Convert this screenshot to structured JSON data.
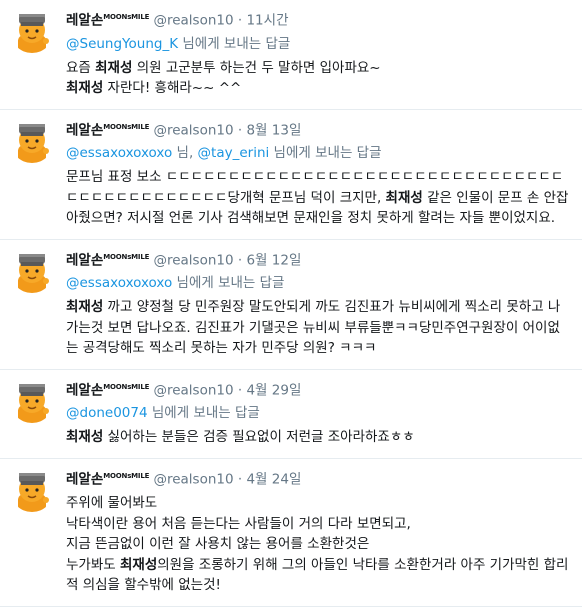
{
  "user": {
    "name": "레알손",
    "badge": "MOONsMILE",
    "handle": "@realson10"
  },
  "reply_suffix": "님에게 보내는 답글",
  "highlight": "최재성",
  "tweets": [
    {
      "time": "11시간",
      "reply_to": "@SeungYoung_K",
      "reply_to_2": "",
      "lines": [
        [
          "요즘 ",
          "최재성",
          " 의원 고군분투 하는건 두 말하면 입아파요~"
        ],
        [
          "",
          "최재성",
          " 자란다! 흥해라~~ ^^"
        ]
      ]
    },
    {
      "time": "8월 13일",
      "reply_to": "@essaxoxoxoxo",
      "reply_to_2": "@tay_erini",
      "lines": [
        [
          "문프님 표정 보소 ㄷㄷㄷㄷㄷㄷㄷㄷㄷㄷㄷㄷㄷㄷㄷㄷㄷㄷㄷㄷㄷㄷㄷㄷㄷㄷㄷㄷㄷㄷㄷㄷㄷㄷㄷㄷㄷㄷㄷㄷㄷㄷㄷㄷㄷ당개혁 문프님 덕이 크지만, ",
          "최재성",
          " 같은 인물이 문프 손 안잡아줬으면? 저시절 언론 기사 검색해보면 문재인을 정치 못하게 할려는 자들 뿐이었지요."
        ]
      ]
    },
    {
      "time": "6월 12일",
      "reply_to": "@essaxoxoxoxo",
      "reply_to_2": "",
      "lines": [
        [
          "",
          "최재성",
          " 까고 양정철 당 민주원장 말도안되게 까도 김진표가 뉴비씨에게 찍소리 못하고 나가는것 보면 답나오죠. 김진표가 기댈곳은 뉴비씨 부류들뿐ㅋㅋ당민주연구원장이 어이없는 공격당해도 찍소리 못하는 자가 민주당 의원? ㅋㅋㅋ"
        ]
      ]
    },
    {
      "time": "4월 29일",
      "reply_to": "@done0074",
      "reply_to_2": "",
      "lines": [
        [
          "",
          "최재성",
          " 싫어하는 분들은 검증 필요없이 저런글 조아라하죠ㅎㅎ"
        ]
      ]
    },
    {
      "time": "4월 24일",
      "reply_to": "",
      "reply_to_2": "",
      "lines": [
        [
          "주위에 물어봐도",
          "",
          ""
        ],
        [
          "낙타색이란 용어 처음 듣는다는 사람들이 거의 다라 보면되고,",
          "",
          ""
        ],
        [
          "지금 뜬금없이 이런 잘 사용치 않는 용어를 소환한것은",
          "",
          ""
        ],
        [
          "누가봐도 ",
          "최재성",
          "의원을 조롱하기 위해 그의 아들인 낙타를 소환한거라 아주 기가막힌 합리적 의심을 할수밖에 없는것!"
        ]
      ]
    }
  ],
  "colors": {
    "link": "#1b95e0",
    "muted": "#657786",
    "text": "#14171a",
    "divider": "#e6ecf0"
  },
  "icons": {
    "avatar": "cartoon-character-avatar-icon"
  }
}
